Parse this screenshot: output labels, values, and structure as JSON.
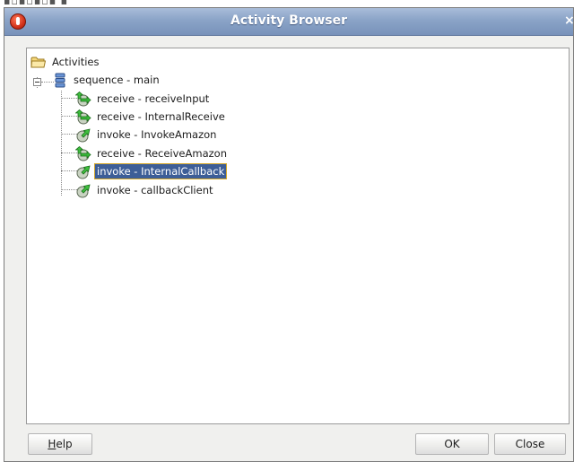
{
  "dialog": {
    "title": "Activity Browser"
  },
  "tree": {
    "root": {
      "label": "Activities",
      "icon": "folder-icon"
    },
    "sequence": {
      "label": "sequence - main",
      "icon": "sequence-icon"
    },
    "activities": [
      {
        "label": "receive - receiveInput",
        "icon": "receive-icon",
        "selected": false
      },
      {
        "label": "receive - InternalReceive",
        "icon": "receive-icon",
        "selected": false
      },
      {
        "label": "invoke - InvokeAmazon",
        "icon": "invoke-icon",
        "selected": false
      },
      {
        "label": "receive - ReceiveAmazon",
        "icon": "receive-icon",
        "selected": false
      },
      {
        "label": "invoke - InternalCallback",
        "icon": "invoke-icon",
        "selected": true
      },
      {
        "label": "invoke - callbackClient",
        "icon": "invoke-icon",
        "selected": false
      }
    ]
  },
  "buttons": {
    "help_mnemonic": "H",
    "help_rest": "elp",
    "ok": "OK",
    "close": "Close"
  },
  "colors": {
    "titlebar": "#8aa3c7",
    "selection": "#3d5e97",
    "selection_border": "#d5a82a",
    "dialog_bg": "#f0f0ee"
  }
}
